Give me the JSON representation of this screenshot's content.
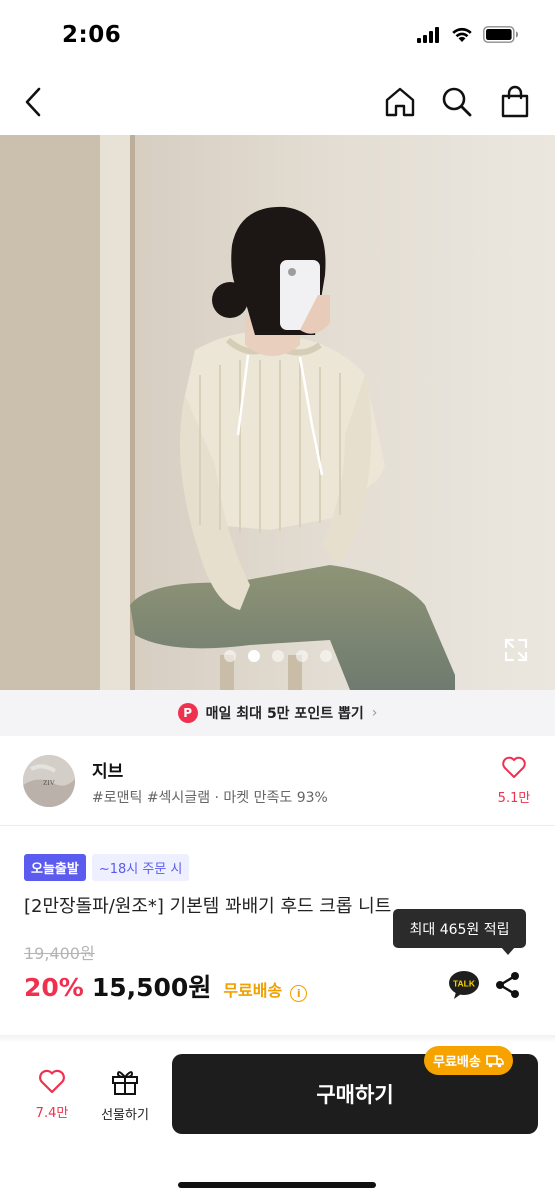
{
  "status_bar": {
    "time": "2:06"
  },
  "header": {
    "back_icon": "chevron-left-icon",
    "home_icon": "home-icon",
    "search_icon": "search-icon",
    "cart_icon": "shopping-bag-icon"
  },
  "gallery": {
    "page_count": 5,
    "active_index": 1,
    "expand_icon": "expand-icon"
  },
  "point_banner": {
    "badge": "P",
    "text": "매일 최대 5만 포인트 뽑기",
    "chevron": "›"
  },
  "store": {
    "avatar_text": "ZIV",
    "name": "지브",
    "tags": "#로맨틱 #섹시글램 · 마켓 만족도 93%",
    "like_count": "5.1만"
  },
  "product": {
    "badge_today": "오늘출발",
    "badge_order": "~18시 주문 시",
    "title": "[2만장돌파/원조*] 기본템 꽈배기 후드 크롭 니트",
    "tooltip": "최대 465원 적립",
    "original_price": "19,400원",
    "discount": "20%",
    "price": "15,500원",
    "shipping": "무료배송",
    "info_icon": "i",
    "talk_label": "TALK"
  },
  "bottom_bar": {
    "like_count": "7.4만",
    "gift_label": "선물하기",
    "buy_label": "구매하기",
    "free_ship_label": "무료배송"
  },
  "colors": {
    "accent": "#f0304f",
    "badge_purple": "#5b5bf0",
    "shipping": "#f0a000",
    "buy_button": "#1d1d1d"
  }
}
